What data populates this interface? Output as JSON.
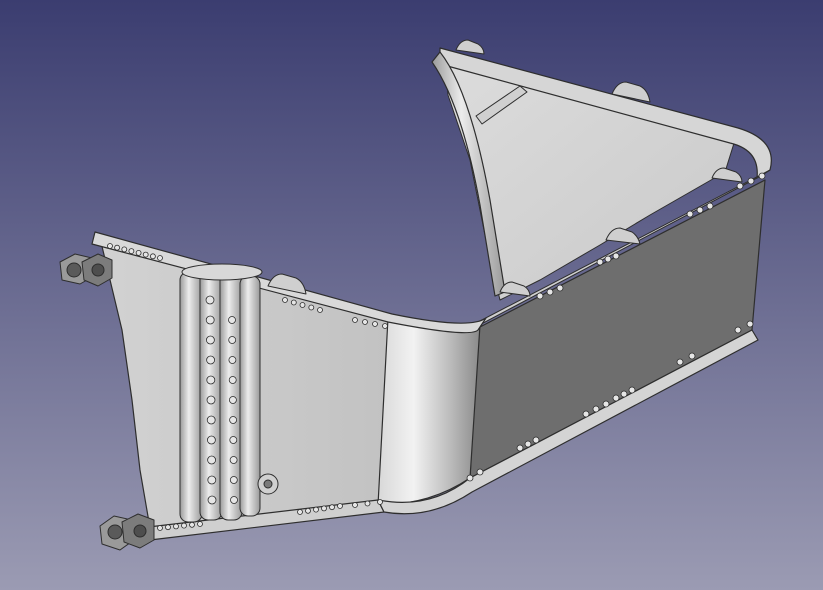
{
  "viewport": {
    "background_top": "#3b3d70",
    "background_bottom": "#9b9bb3",
    "model_light": "#e2e2e2",
    "model_mid": "#c6c6c6",
    "model_dark": "#6e6e6e",
    "edge_color": "#2e2e2e"
  }
}
